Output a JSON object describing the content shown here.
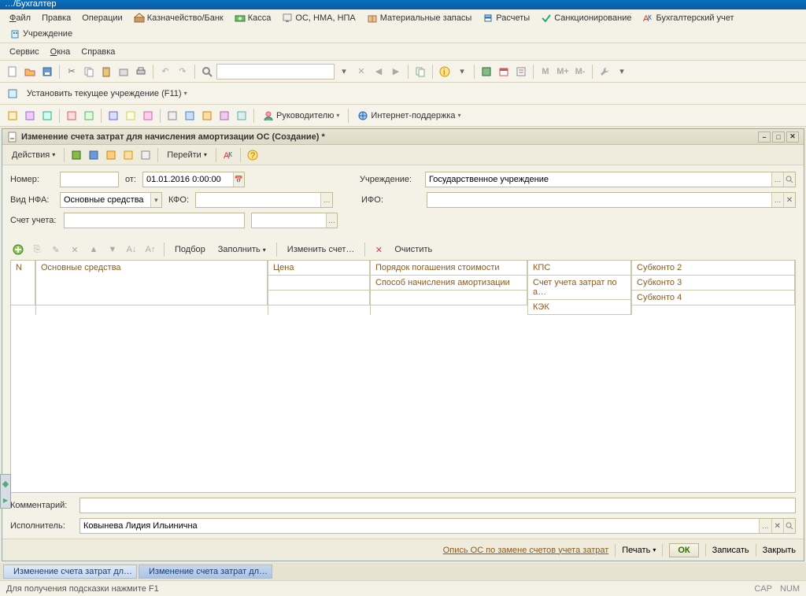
{
  "title": "…/Бухгалтер",
  "menu": {
    "row1": [
      {
        "k": "file",
        "label": "Файл",
        "u": 1
      },
      {
        "k": "edit",
        "label": "Правка",
        "u": 0
      },
      {
        "k": "ops",
        "label": "Операции",
        "u": 0
      },
      {
        "k": "treasury",
        "label": "Казначейство/Банк",
        "icon": "bank"
      },
      {
        "k": "kassa",
        "label": "Касса",
        "icon": "cash"
      },
      {
        "k": "os",
        "label": "ОС, НМА, НПА",
        "icon": "os"
      },
      {
        "k": "mat",
        "label": "Материальные запасы",
        "icon": "box"
      },
      {
        "k": "calc",
        "label": "Расчеты",
        "icon": "calc"
      },
      {
        "k": "sanc",
        "label": "Санкционирование",
        "icon": "check"
      },
      {
        "k": "acct",
        "label": "Бухгалтерский учет",
        "icon": "ledger"
      },
      {
        "k": "inst",
        "label": "Учреждение",
        "icon": "building"
      }
    ],
    "row2": [
      {
        "k": "service",
        "label": "Сервис",
        "u": 0
      },
      {
        "k": "windows",
        "label": "Окна",
        "u": 0
      },
      {
        "k": "help",
        "label": "Справка",
        "u": 0
      }
    ]
  },
  "toolbar1": {
    "set_institution": "Установить текущее учреждение (F11)"
  },
  "toolbar3": {
    "manager": "Руководителю",
    "support": "Интернет-поддержка"
  },
  "doc": {
    "title": "Изменение счета затрат для начисления амортизации ОС (Создание) *",
    "actions": "Действия",
    "goto": "Перейти",
    "number_label": "Номер:",
    "number_value": "",
    "from_label": "от:",
    "date_value": "01.01.2016 0:00:00",
    "nfa_label": "Вид НФА:",
    "nfa_value": "Основные средства",
    "kfo_label": "КФО:",
    "kfo_value": "",
    "account_label": "Счет учета:",
    "account_value": "",
    "inst_label": "Учреждение:",
    "inst_value": "Государственное учреждение",
    "ifo_label": "ИФО:",
    "ifo_value": "",
    "grid_tb": {
      "select": "Подбор",
      "fill": "Заполнить",
      "change": "Изменить счет…",
      "clear": "Очистить"
    },
    "grid_headers": {
      "n": "N",
      "main": "Основные средства",
      "price_col": [
        {
          "row": 0,
          "text": "Цена"
        },
        {
          "row": 1,
          "text": ""
        },
        {
          "row": 2,
          "text": ""
        }
      ],
      "order_col": [
        {
          "row": 0,
          "text": "Порядок погашения стоимости"
        },
        {
          "row": 1,
          "text": "Способ начисления амортизации"
        },
        {
          "row": 2,
          "text": ""
        }
      ],
      "kps_col": [
        {
          "row": 0,
          "text": "КПС"
        },
        {
          "row": 1,
          "text": "Счет учета затрат по а…"
        },
        {
          "row": 2,
          "text": "КЭК"
        }
      ],
      "sub_col": [
        {
          "row": 0,
          "text": "Субконто 2"
        },
        {
          "row": 1,
          "text": "Субконто 3"
        },
        {
          "row": 2,
          "text": "Субконто 4"
        }
      ]
    },
    "comment_label": "Комментарий:",
    "comment_value": "",
    "executor_label": "Исполнитель:",
    "executor_value": "Ковынева Лидия Ильинична",
    "footer": {
      "link": "Опись ОС по замене счетов учета затрат",
      "print": "Печать",
      "ok": "ОК",
      "save": "Записать",
      "close": "Закрыть"
    }
  },
  "tabs": [
    "Изменение счета затрат дл…",
    "Изменение счета затрат дл…"
  ],
  "status": {
    "hint": "Для получения подсказки нажмите F1",
    "cap": "CAP",
    "num": "NUM"
  }
}
